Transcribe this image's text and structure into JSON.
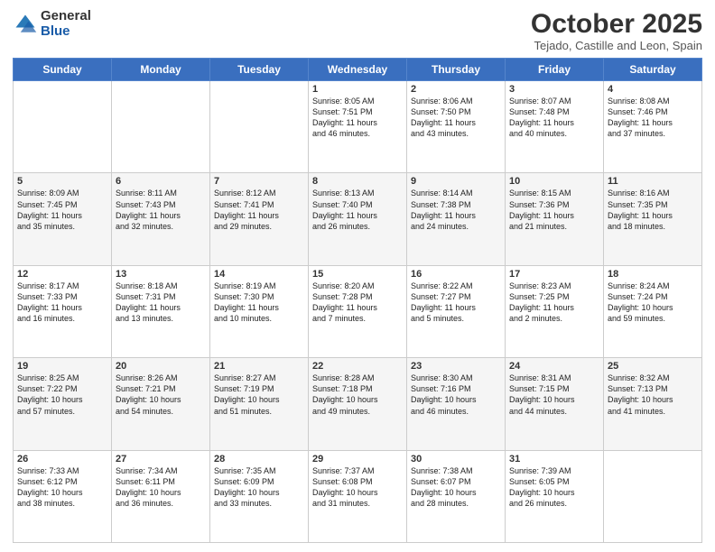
{
  "header": {
    "logo_general": "General",
    "logo_blue": "Blue",
    "month_title": "October 2025",
    "subtitle": "Tejado, Castille and Leon, Spain"
  },
  "weekdays": [
    "Sunday",
    "Monday",
    "Tuesday",
    "Wednesday",
    "Thursday",
    "Friday",
    "Saturday"
  ],
  "weeks": [
    [
      {
        "day": "",
        "info": ""
      },
      {
        "day": "",
        "info": ""
      },
      {
        "day": "",
        "info": ""
      },
      {
        "day": "1",
        "info": "Sunrise: 8:05 AM\nSunset: 7:51 PM\nDaylight: 11 hours\nand 46 minutes."
      },
      {
        "day": "2",
        "info": "Sunrise: 8:06 AM\nSunset: 7:50 PM\nDaylight: 11 hours\nand 43 minutes."
      },
      {
        "day": "3",
        "info": "Sunrise: 8:07 AM\nSunset: 7:48 PM\nDaylight: 11 hours\nand 40 minutes."
      },
      {
        "day": "4",
        "info": "Sunrise: 8:08 AM\nSunset: 7:46 PM\nDaylight: 11 hours\nand 37 minutes."
      }
    ],
    [
      {
        "day": "5",
        "info": "Sunrise: 8:09 AM\nSunset: 7:45 PM\nDaylight: 11 hours\nand 35 minutes."
      },
      {
        "day": "6",
        "info": "Sunrise: 8:11 AM\nSunset: 7:43 PM\nDaylight: 11 hours\nand 32 minutes."
      },
      {
        "day": "7",
        "info": "Sunrise: 8:12 AM\nSunset: 7:41 PM\nDaylight: 11 hours\nand 29 minutes."
      },
      {
        "day": "8",
        "info": "Sunrise: 8:13 AM\nSunset: 7:40 PM\nDaylight: 11 hours\nand 26 minutes."
      },
      {
        "day": "9",
        "info": "Sunrise: 8:14 AM\nSunset: 7:38 PM\nDaylight: 11 hours\nand 24 minutes."
      },
      {
        "day": "10",
        "info": "Sunrise: 8:15 AM\nSunset: 7:36 PM\nDaylight: 11 hours\nand 21 minutes."
      },
      {
        "day": "11",
        "info": "Sunrise: 8:16 AM\nSunset: 7:35 PM\nDaylight: 11 hours\nand 18 minutes."
      }
    ],
    [
      {
        "day": "12",
        "info": "Sunrise: 8:17 AM\nSunset: 7:33 PM\nDaylight: 11 hours\nand 16 minutes."
      },
      {
        "day": "13",
        "info": "Sunrise: 8:18 AM\nSunset: 7:31 PM\nDaylight: 11 hours\nand 13 minutes."
      },
      {
        "day": "14",
        "info": "Sunrise: 8:19 AM\nSunset: 7:30 PM\nDaylight: 11 hours\nand 10 minutes."
      },
      {
        "day": "15",
        "info": "Sunrise: 8:20 AM\nSunset: 7:28 PM\nDaylight: 11 hours\nand 7 minutes."
      },
      {
        "day": "16",
        "info": "Sunrise: 8:22 AM\nSunset: 7:27 PM\nDaylight: 11 hours\nand 5 minutes."
      },
      {
        "day": "17",
        "info": "Sunrise: 8:23 AM\nSunset: 7:25 PM\nDaylight: 11 hours\nand 2 minutes."
      },
      {
        "day": "18",
        "info": "Sunrise: 8:24 AM\nSunset: 7:24 PM\nDaylight: 10 hours\nand 59 minutes."
      }
    ],
    [
      {
        "day": "19",
        "info": "Sunrise: 8:25 AM\nSunset: 7:22 PM\nDaylight: 10 hours\nand 57 minutes."
      },
      {
        "day": "20",
        "info": "Sunrise: 8:26 AM\nSunset: 7:21 PM\nDaylight: 10 hours\nand 54 minutes."
      },
      {
        "day": "21",
        "info": "Sunrise: 8:27 AM\nSunset: 7:19 PM\nDaylight: 10 hours\nand 51 minutes."
      },
      {
        "day": "22",
        "info": "Sunrise: 8:28 AM\nSunset: 7:18 PM\nDaylight: 10 hours\nand 49 minutes."
      },
      {
        "day": "23",
        "info": "Sunrise: 8:30 AM\nSunset: 7:16 PM\nDaylight: 10 hours\nand 46 minutes."
      },
      {
        "day": "24",
        "info": "Sunrise: 8:31 AM\nSunset: 7:15 PM\nDaylight: 10 hours\nand 44 minutes."
      },
      {
        "day": "25",
        "info": "Sunrise: 8:32 AM\nSunset: 7:13 PM\nDaylight: 10 hours\nand 41 minutes."
      }
    ],
    [
      {
        "day": "26",
        "info": "Sunrise: 7:33 AM\nSunset: 6:12 PM\nDaylight: 10 hours\nand 38 minutes."
      },
      {
        "day": "27",
        "info": "Sunrise: 7:34 AM\nSunset: 6:11 PM\nDaylight: 10 hours\nand 36 minutes."
      },
      {
        "day": "28",
        "info": "Sunrise: 7:35 AM\nSunset: 6:09 PM\nDaylight: 10 hours\nand 33 minutes."
      },
      {
        "day": "29",
        "info": "Sunrise: 7:37 AM\nSunset: 6:08 PM\nDaylight: 10 hours\nand 31 minutes."
      },
      {
        "day": "30",
        "info": "Sunrise: 7:38 AM\nSunset: 6:07 PM\nDaylight: 10 hours\nand 28 minutes."
      },
      {
        "day": "31",
        "info": "Sunrise: 7:39 AM\nSunset: 6:05 PM\nDaylight: 10 hours\nand 26 minutes."
      },
      {
        "day": "",
        "info": ""
      }
    ]
  ]
}
